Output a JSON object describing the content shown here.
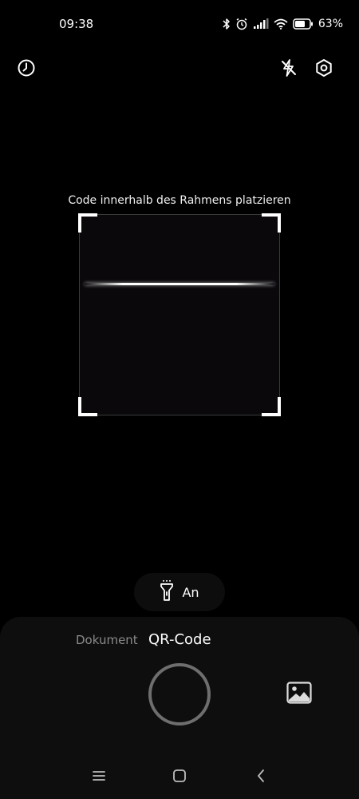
{
  "status_bar": {
    "time": "09:38",
    "battery_percent": "63%",
    "battery_level": 0.63,
    "icons": [
      "bluetooth-icon",
      "alarm-icon",
      "signal-icon",
      "wifi-icon",
      "battery-icon"
    ]
  },
  "toolbar": {
    "left_icon": "history-icon",
    "right_icons": [
      "flash-off-icon",
      "settings-icon"
    ]
  },
  "scanner": {
    "hint": "Code innerhalb des Rahmens platzieren"
  },
  "torch": {
    "label": "An",
    "icon": "flashlight-icon"
  },
  "modes": {
    "document": "Dokument",
    "qr_code": "QR-Code",
    "active": "QR-Code"
  },
  "controls": {
    "gallery_icon": "image-icon",
    "shutter_icon": "shutter-icon"
  },
  "nav": {
    "icons": [
      "menu-icon",
      "home-icon",
      "back-icon"
    ]
  },
  "colors": {
    "background": "#000000",
    "panel": "#0e0e0e",
    "inactive_text": "#8a8a8a",
    "shutter_ring": "#6e6e6e"
  }
}
